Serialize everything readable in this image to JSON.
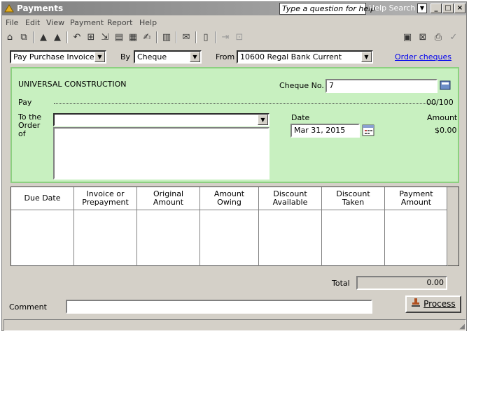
{
  "window": {
    "title": "Payments",
    "help_placeholder": "Type a question for help",
    "help_search": "Help Search",
    "min": "_",
    "max": "□",
    "close": "×"
  },
  "menu": [
    "File",
    "Edit",
    "View",
    "Payment",
    "Report",
    "Help"
  ],
  "header": {
    "type_value": "Pay Purchase Invoices",
    "by_label": "By",
    "by_value": "Cheque",
    "from_label": "From",
    "from_value": "10600 Regal Bank Current",
    "order_link": "Order cheques"
  },
  "cheque": {
    "payee_company": "UNIVERSAL CONSTRUCTION",
    "cheque_no_label": "Cheque No.",
    "cheque_no_value": "7",
    "pay_label": "Pay",
    "pay_suffix": "00/100",
    "to_order_label": "To the Order of",
    "date_label": "Date",
    "date_value": "Mar 31, 2015",
    "amount_label": "Amount",
    "amount_value": "$0.00"
  },
  "table": {
    "headers": [
      "Due Date",
      "Invoice or Prepayment",
      "Original Amount",
      "Amount Owing",
      "Discount Available",
      "Discount Taken",
      "Payment Amount"
    ]
  },
  "footer": {
    "total_label": "Total",
    "total_value": "0.00",
    "comment_label": "Comment",
    "comment_value": "",
    "process_label": "Process"
  }
}
